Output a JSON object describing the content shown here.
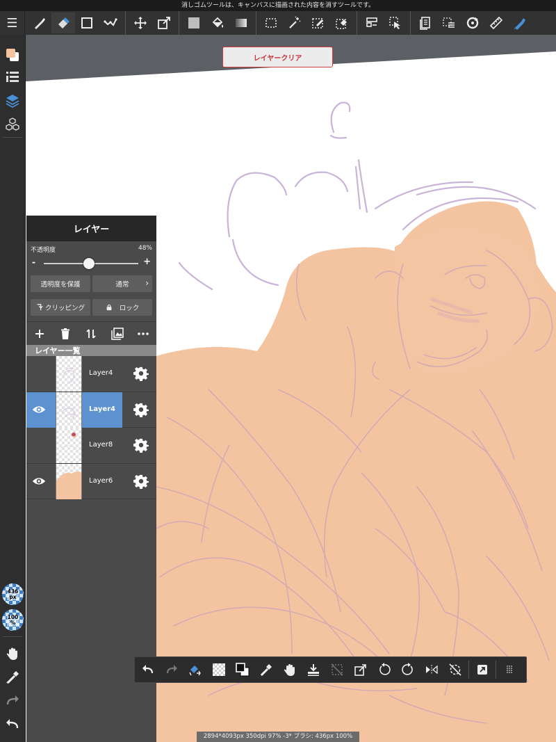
{
  "tip_text": "消しゴムツールは、キャンバスに描画された内容を消すツールです。",
  "toolbar": {
    "menu_icon": "☰",
    "groups": [
      [
        "brush-icon",
        "eraser-icon",
        "shape-icon",
        "dot-icon"
      ],
      [
        "move-icon",
        "transform-icon"
      ],
      [
        "fill-color-icon",
        "bucket-icon",
        "gradient-icon"
      ],
      [
        "select-rect-icon",
        "magic-wand-icon",
        "select-pen-icon",
        "select-eraser-icon"
      ],
      [
        "layout-icon",
        "operation-icon"
      ],
      [
        "material-icon",
        "select-all-icon",
        "rotate-icon",
        "ruler-icon",
        "pen-blue-icon"
      ]
    ],
    "active_tool": "eraser-icon"
  },
  "canvas": {
    "clear_button_label": "レイヤークリア"
  },
  "sidebar": {
    "brush_size": "436\npx",
    "brush_opacity": "100\n%"
  },
  "layer_panel": {
    "title": "レイヤー",
    "opacity_label": "不透明度",
    "opacity_value": "48%",
    "opacity_fraction": 0.48,
    "slider_minus": "-",
    "slider_plus": "+",
    "protect_label": "透明度を保護",
    "blend_label": "通常",
    "clipping_label": "クリッピング",
    "lock_label": "ロック",
    "list_header": "レイヤー一覧",
    "layers": [
      {
        "name": "Layer4",
        "visible": false,
        "selected": false
      },
      {
        "name": "Layer4",
        "visible": true,
        "selected": true
      },
      {
        "name": "Layer8",
        "visible": false,
        "selected": false
      },
      {
        "name": "Layer6",
        "visible": true,
        "selected": false
      }
    ]
  },
  "status_text": "2894*4093px 350dpi 97% -3* ブラシ: 436px 100%",
  "colors": {
    "accent_blue": "#5b92cf",
    "skin": "#f4c4a1",
    "sketch": "#c8b4d8",
    "clear_red": "#d23c3c"
  }
}
